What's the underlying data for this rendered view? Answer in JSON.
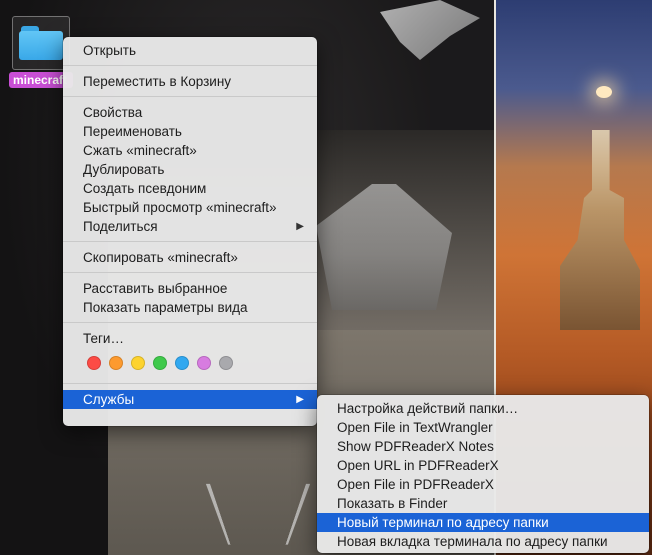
{
  "desktop": {
    "folder_label": "minecraft"
  },
  "context_menu": {
    "groups": [
      [
        {
          "label": "Открыть",
          "name": "menu-item-open"
        }
      ],
      [
        {
          "label": "Переместить в Корзину",
          "name": "menu-item-move-to-trash"
        }
      ],
      [
        {
          "label": "Свойства",
          "name": "menu-item-get-info"
        },
        {
          "label": "Переименовать",
          "name": "menu-item-rename"
        },
        {
          "label": "Сжать «minecraft»",
          "name": "menu-item-compress"
        },
        {
          "label": "Дублировать",
          "name": "menu-item-duplicate"
        },
        {
          "label": "Создать псевдоним",
          "name": "menu-item-make-alias"
        },
        {
          "label": "Быстрый просмотр «minecraft»",
          "name": "menu-item-quick-look"
        },
        {
          "label": "Поделиться",
          "name": "menu-item-share",
          "submenu": true
        }
      ],
      [
        {
          "label": "Скопировать «minecraft»",
          "name": "menu-item-copy"
        }
      ],
      [
        {
          "label": "Расставить выбранное",
          "name": "menu-item-clean-up-selection"
        },
        {
          "label": "Показать параметры вида",
          "name": "menu-item-show-view-options"
        }
      ]
    ],
    "tags_label": "Теги…",
    "tag_colors": [
      "#fc4b45",
      "#fd9a2e",
      "#fdd32f",
      "#3fc94b",
      "#31a8f0",
      "#d77ce0",
      "#a9a9ad"
    ],
    "services": {
      "label": "Службы",
      "highlighted": true
    }
  },
  "services_submenu": {
    "items": [
      {
        "label": "Настройка действий папки…",
        "name": "submenu-item-folder-actions-setup"
      },
      {
        "label": "Open File in TextWrangler",
        "name": "submenu-item-open-textwrangler"
      },
      {
        "label": "Show PDFReaderX Notes",
        "name": "submenu-item-pdfreaderx-notes"
      },
      {
        "label": "Open URL in PDFReaderX",
        "name": "submenu-item-open-url-pdfreaderx"
      },
      {
        "label": "Open File in PDFReaderX",
        "name": "submenu-item-open-file-pdfreaderx"
      },
      {
        "label": "Показать в Finder",
        "name": "submenu-item-reveal-in-finder"
      },
      {
        "label": "Новый терминал по адресу папки",
        "name": "submenu-item-new-terminal-at-folder",
        "highlighted": true
      },
      {
        "label": "Новая вкладка терминала по адресу папки",
        "name": "submenu-item-new-terminal-tab-at-folder"
      }
    ]
  }
}
